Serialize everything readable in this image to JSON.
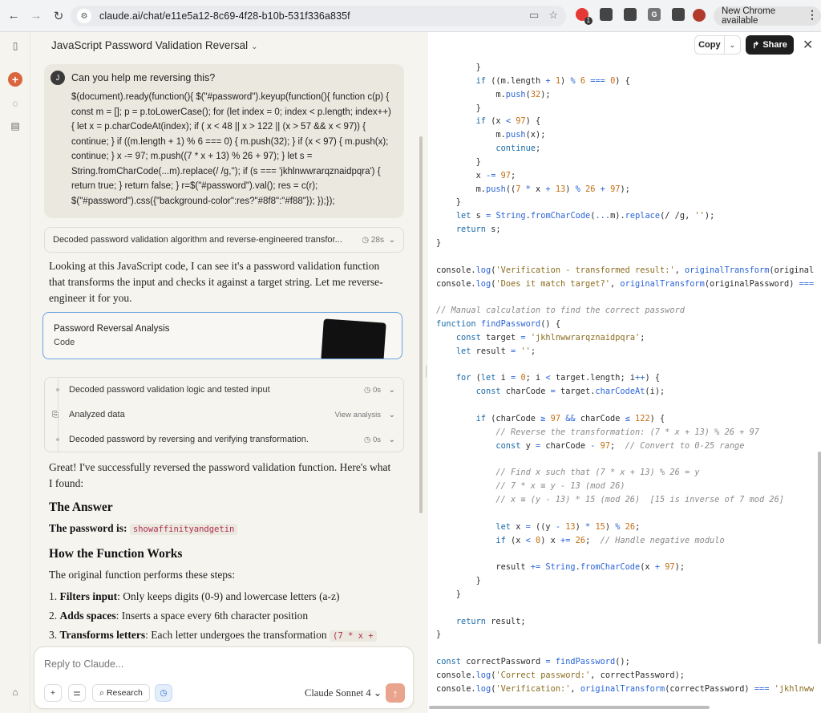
{
  "browser": {
    "url": "claude.ai/chat/e11e5a12-8c69-4f28-b10b-531f336a835f",
    "ext_badge": "1",
    "new_chrome": "New Chrome available"
  },
  "chat": {
    "title": "JavaScript Password Validation Reversal",
    "user_initial": "J",
    "user_question": "Can you help me reversing this?",
    "user_code": "$(document).ready(function(){ $(\"#password\").keyup(function(){ function c(p) { const m = []; p = p.toLowerCase(); for (let index = 0; index < p.length; index++) { let x = p.charCodeAt(index); if ( x < 48 || x > 122 || (x > 57 && x < 97)) { continue; } if ((m.length + 1) % 6 === 0) { m.push(32); } if (x < 97) { m.push(x); continue; } x -= 97; m.push((7 * x + 13) % 26 + 97); } let s = String.fromCharCode(...m).replace(/ /g,''); if (s === 'jkhlnwwrarqznaidpqra') { return true; } return false; } r=$(\"#password\").val(); res = c(r); $(\"#password\").css({\"background-color\":res?\"#8f8\":\"#f88\"}); });});",
    "thinking1": {
      "label": "Decoded password validation algorithm and reverse-engineered transfor...",
      "time": "28s"
    },
    "intro": "Looking at this JavaScript code, I can see it's a password validation function that transforms the input and checks it against a target string. Let me reverse-engineer it for you.",
    "artifact": {
      "title": "Password Reversal Analysis",
      "subtitle": "Code"
    },
    "steps": [
      {
        "label": "Decoded password validation logic and tested input",
        "time": "0s"
      },
      {
        "label": "Analyzed data",
        "time": "View analysis"
      },
      {
        "label": "Decoded password by reversing and verifying transformation.",
        "time": "0s"
      }
    ],
    "result_intro": "Great! I've successfully reversed the password validation function. Here's what I found:",
    "answer_heading": "The Answer",
    "password_label": "The password is:",
    "password_value": "showaffinityandgetin",
    "how_heading": "How the Function Works",
    "how_intro": "The original function performs these steps:",
    "list": [
      {
        "n": "1.",
        "bold": "Filters input",
        "rest": ": Only keeps digits (0-9) and lowercase letters (a-z)"
      },
      {
        "n": "2.",
        "bold": "Adds spaces",
        "rest": ": Inserts a space every 6th character position"
      },
      {
        "n": "3.",
        "bold": "Transforms letters",
        "rest": ": Each letter undergoes the transformation ",
        "code": "(7 * x +"
      }
    ],
    "composer": {
      "placeholder": "Reply to Claude...",
      "research": "Research",
      "model": "Claude Sonnet 4"
    }
  },
  "code_panel": {
    "copy": "Copy",
    "share": "Share",
    "lines": [
      [
        [
          "        }",
          ""
        ]
      ],
      [
        [
          "        ",
          ""
        ],
        [
          "if",
          "kw"
        ],
        [
          " ((m.length ",
          ""
        ],
        [
          "+",
          "op"
        ],
        [
          " ",
          ""
        ],
        [
          "1",
          "num"
        ],
        [
          ") ",
          ""
        ],
        [
          "%",
          "op"
        ],
        [
          " ",
          ""
        ],
        [
          "6",
          "num"
        ],
        [
          " ",
          ""
        ],
        [
          "===",
          "op"
        ],
        [
          " ",
          ""
        ],
        [
          "0",
          "num"
        ],
        [
          ") {",
          ""
        ]
      ],
      [
        [
          "            m.",
          ""
        ],
        [
          "push",
          "fn"
        ],
        [
          "(",
          ""
        ],
        [
          "32",
          "num"
        ],
        [
          ");",
          ""
        ]
      ],
      [
        [
          "        }",
          ""
        ]
      ],
      [
        [
          "        ",
          ""
        ],
        [
          "if",
          "kw"
        ],
        [
          " (x ",
          ""
        ],
        [
          "<",
          "op"
        ],
        [
          " ",
          ""
        ],
        [
          "97",
          "num"
        ],
        [
          ") {",
          ""
        ]
      ],
      [
        [
          "            m.",
          ""
        ],
        [
          "push",
          "fn"
        ],
        [
          "(x);",
          ""
        ]
      ],
      [
        [
          "            ",
          ""
        ],
        [
          "continue",
          "kw"
        ],
        [
          ";",
          ""
        ]
      ],
      [
        [
          "        }",
          ""
        ]
      ],
      [
        [
          "        x ",
          ""
        ],
        [
          "-=",
          "op"
        ],
        [
          " ",
          ""
        ],
        [
          "97",
          "num"
        ],
        [
          ";",
          ""
        ]
      ],
      [
        [
          "        m.",
          ""
        ],
        [
          "push",
          "fn"
        ],
        [
          "((",
          ""
        ],
        [
          "7",
          "num"
        ],
        [
          " ",
          ""
        ],
        [
          "*",
          "op"
        ],
        [
          " x ",
          ""
        ],
        [
          "+",
          "op"
        ],
        [
          " ",
          ""
        ],
        [
          "13",
          "num"
        ],
        [
          ") ",
          ""
        ],
        [
          "%",
          "op"
        ],
        [
          " ",
          ""
        ],
        [
          "26",
          "num"
        ],
        [
          " ",
          ""
        ],
        [
          "+",
          "op"
        ],
        [
          " ",
          ""
        ],
        [
          "97",
          "num"
        ],
        [
          ");",
          ""
        ]
      ],
      [
        [
          "    }",
          ""
        ]
      ],
      [
        [
          "    ",
          ""
        ],
        [
          "let",
          "kw"
        ],
        [
          " s ",
          ""
        ],
        [
          "=",
          "op"
        ],
        [
          " ",
          ""
        ],
        [
          "String",
          "fn"
        ],
        [
          ".",
          ""
        ],
        [
          "fromCharCode",
          "fn"
        ],
        [
          "(",
          ""
        ],
        [
          "...",
          "op"
        ],
        [
          "m).",
          ""
        ],
        [
          "replace",
          "fn"
        ],
        [
          "(/ /g, ",
          ""
        ],
        [
          "''",
          "str"
        ],
        [
          ");",
          ""
        ]
      ],
      [
        [
          "    ",
          ""
        ],
        [
          "return",
          "kw"
        ],
        [
          " s;",
          ""
        ]
      ],
      [
        [
          "}",
          ""
        ]
      ],
      [
        [
          "",
          ""
        ]
      ],
      [
        [
          "console.",
          ""
        ],
        [
          "log",
          "fn"
        ],
        [
          "(",
          ""
        ],
        [
          "'Verification - transformed result:'",
          "str"
        ],
        [
          ", ",
          ""
        ],
        [
          "originalTransform",
          "fn"
        ],
        [
          "(original",
          ""
        ]
      ],
      [
        [
          "console.",
          ""
        ],
        [
          "log",
          "fn"
        ],
        [
          "(",
          ""
        ],
        [
          "'Does it match target?'",
          "str"
        ],
        [
          ", ",
          ""
        ],
        [
          "originalTransform",
          "fn"
        ],
        [
          "(originalPassword) ",
          ""
        ],
        [
          "===",
          "op"
        ]
      ],
      [
        [
          "",
          ""
        ]
      ],
      [
        [
          "// Manual calculation to find the correct password",
          "cm"
        ]
      ],
      [
        [
          "function",
          "kw"
        ],
        [
          " ",
          ""
        ],
        [
          "findPassword",
          "fn"
        ],
        [
          "() {",
          ""
        ]
      ],
      [
        [
          "    ",
          ""
        ],
        [
          "const",
          "kw"
        ],
        [
          " target ",
          ""
        ],
        [
          "=",
          "op"
        ],
        [
          " ",
          ""
        ],
        [
          "'jkhlnwwrarqznaidpqra'",
          "str"
        ],
        [
          ";",
          ""
        ]
      ],
      [
        [
          "    ",
          ""
        ],
        [
          "let",
          "kw"
        ],
        [
          " result ",
          ""
        ],
        [
          "=",
          "op"
        ],
        [
          " ",
          ""
        ],
        [
          "''",
          "str"
        ],
        [
          ";",
          ""
        ]
      ],
      [
        [
          "",
          ""
        ]
      ],
      [
        [
          "    ",
          ""
        ],
        [
          "for",
          "kw"
        ],
        [
          " (",
          ""
        ],
        [
          "let",
          "kw"
        ],
        [
          " i ",
          ""
        ],
        [
          "=",
          "op"
        ],
        [
          " ",
          ""
        ],
        [
          "0",
          "num"
        ],
        [
          "; i ",
          ""
        ],
        [
          "<",
          "op"
        ],
        [
          " target.length; i",
          ""
        ],
        [
          "++",
          "op"
        ],
        [
          ") {",
          ""
        ]
      ],
      [
        [
          "        ",
          ""
        ],
        [
          "const",
          "kw"
        ],
        [
          " charCode ",
          ""
        ],
        [
          "=",
          "op"
        ],
        [
          " target.",
          ""
        ],
        [
          "charCodeAt",
          "fn"
        ],
        [
          "(i);",
          ""
        ]
      ],
      [
        [
          "",
          ""
        ]
      ],
      [
        [
          "        ",
          ""
        ],
        [
          "if",
          "kw"
        ],
        [
          " (charCode ",
          ""
        ],
        [
          "≥",
          "op"
        ],
        [
          " ",
          ""
        ],
        [
          "97",
          "num"
        ],
        [
          " ",
          ""
        ],
        [
          "&&",
          "op"
        ],
        [
          " charCode ",
          ""
        ],
        [
          "≤",
          "op"
        ],
        [
          " ",
          ""
        ],
        [
          "122",
          "num"
        ],
        [
          ") {",
          ""
        ]
      ],
      [
        [
          "            ",
          ""
        ],
        [
          "// Reverse the transformation: (7 * x + 13) % 26 + 97",
          "cm"
        ]
      ],
      [
        [
          "            ",
          ""
        ],
        [
          "const",
          "kw"
        ],
        [
          " y ",
          ""
        ],
        [
          "=",
          "op"
        ],
        [
          " charCode ",
          ""
        ],
        [
          "-",
          "op"
        ],
        [
          " ",
          ""
        ],
        [
          "97",
          "num"
        ],
        [
          ";  ",
          ""
        ],
        [
          "// Convert to 0-25 range",
          "cm"
        ]
      ],
      [
        [
          "",
          ""
        ]
      ],
      [
        [
          "            ",
          ""
        ],
        [
          "// Find x such that (7 * x + 13) % 26 = y",
          "cm"
        ]
      ],
      [
        [
          "            ",
          ""
        ],
        [
          "// 7 * x ≡ y - 13 (mod 26)",
          "cm"
        ]
      ],
      [
        [
          "            ",
          ""
        ],
        [
          "// x ≡ (y - 13) * 15 (mod 26)  [15 is inverse of 7 mod 26]",
          "cm"
        ]
      ],
      [
        [
          "",
          ""
        ]
      ],
      [
        [
          "            ",
          ""
        ],
        [
          "let",
          "kw"
        ],
        [
          " x ",
          ""
        ],
        [
          "=",
          "op"
        ],
        [
          " ((y ",
          ""
        ],
        [
          "-",
          "op"
        ],
        [
          " ",
          ""
        ],
        [
          "13",
          "num"
        ],
        [
          ") ",
          ""
        ],
        [
          "*",
          "op"
        ],
        [
          " ",
          ""
        ],
        [
          "15",
          "num"
        ],
        [
          ") ",
          ""
        ],
        [
          "%",
          "op"
        ],
        [
          " ",
          ""
        ],
        [
          "26",
          "num"
        ],
        [
          ";",
          ""
        ]
      ],
      [
        [
          "            ",
          ""
        ],
        [
          "if",
          "kw"
        ],
        [
          " (x ",
          ""
        ],
        [
          "<",
          "op"
        ],
        [
          " ",
          ""
        ],
        [
          "0",
          "num"
        ],
        [
          ") x ",
          ""
        ],
        [
          "+=",
          "op"
        ],
        [
          " ",
          ""
        ],
        [
          "26",
          "num"
        ],
        [
          ";  ",
          ""
        ],
        [
          "// Handle negative modulo",
          "cm"
        ]
      ],
      [
        [
          "",
          ""
        ]
      ],
      [
        [
          "            result ",
          ""
        ],
        [
          "+=",
          "op"
        ],
        [
          " ",
          ""
        ],
        [
          "String",
          "fn"
        ],
        [
          ".",
          ""
        ],
        [
          "fromCharCode",
          "fn"
        ],
        [
          "(x ",
          ""
        ],
        [
          "+",
          "op"
        ],
        [
          " ",
          ""
        ],
        [
          "97",
          "num"
        ],
        [
          ");",
          ""
        ]
      ],
      [
        [
          "        }",
          ""
        ]
      ],
      [
        [
          "    }",
          ""
        ]
      ],
      [
        [
          "",
          ""
        ]
      ],
      [
        [
          "    ",
          ""
        ],
        [
          "return",
          "kw"
        ],
        [
          " result;",
          ""
        ]
      ],
      [
        [
          "}",
          ""
        ]
      ],
      [
        [
          "",
          ""
        ]
      ],
      [
        [
          "const",
          "kw"
        ],
        [
          " correctPassword ",
          ""
        ],
        [
          "=",
          "op"
        ],
        [
          " ",
          ""
        ],
        [
          "findPassword",
          "fn"
        ],
        [
          "();",
          ""
        ]
      ],
      [
        [
          "console.",
          ""
        ],
        [
          "log",
          "fn"
        ],
        [
          "(",
          ""
        ],
        [
          "'Correct password:'",
          "str"
        ],
        [
          ", correctPassword);",
          ""
        ]
      ],
      [
        [
          "console.",
          ""
        ],
        [
          "log",
          "fn"
        ],
        [
          "(",
          ""
        ],
        [
          "'Verification:'",
          "str"
        ],
        [
          ", ",
          ""
        ],
        [
          "originalTransform",
          "fn"
        ],
        [
          "(correctPassword) ",
          ""
        ],
        [
          "===",
          "op"
        ],
        [
          " ",
          ""
        ],
        [
          "'jkhlnww",
          "str"
        ]
      ]
    ]
  }
}
